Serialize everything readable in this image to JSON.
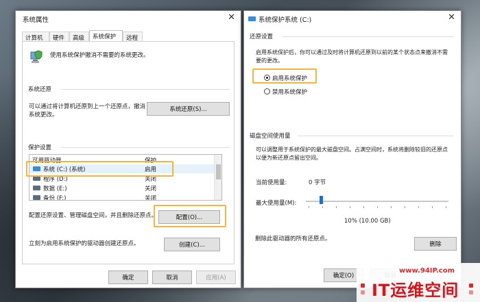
{
  "left_window": {
    "title": "系统属性",
    "tabs": [
      "计算机名",
      "硬件",
      "高级",
      "系统保护",
      "远程"
    ],
    "active_tab": "系统保护",
    "intro": "使用系统保护撤消不需要的系统更改。",
    "restore": {
      "section": "系统还原",
      "desc_line1": "可以通过将计算机还原到上一个还原点，撤消",
      "desc_line2": "系统更改。",
      "button": "系统还原(S)..."
    },
    "protection": {
      "section": "保护设置",
      "col_drives": "可用驱动器",
      "col_protect": "保护",
      "drives": [
        {
          "name": "系统 (C:) (系统)",
          "status": "启用"
        },
        {
          "name": "程序 (D:)",
          "status": "关闭"
        },
        {
          "name": "数据 (E:)",
          "status": "关闭"
        },
        {
          "name": "备份 (F:)",
          "status": "关闭"
        }
      ],
      "config_text": "配置还原设置、管理磁盘空间，并且删除还原点。",
      "config_button": "配置(O)...",
      "create_text": "立刻为启用系统保护的驱动器创建还原点。",
      "create_button": "创建(C)..."
    },
    "footer": {
      "ok": "确定",
      "cancel": "取消",
      "apply": "应用(A)"
    }
  },
  "right_window": {
    "title": "系统保护系统 (C:)",
    "restore_settings": {
      "section": "还原设置",
      "desc_line1": "启用系统保护后，你可以通过及时将计算机还原到以前的某个状态点来撤消不需",
      "desc_line2": "要的更改。",
      "option_on": "启用系统保护",
      "option_off": "禁用系统保护",
      "selected": "启用系统保护"
    },
    "disk": {
      "section": "磁盘空间使用量",
      "desc_line1": "可以调整用于系统保护的最大磁盘空间。占满空间时，系统将删除较旧的还原点",
      "desc_line2": "以便为新还原点留出空间。",
      "current_label": "当前使用量:",
      "current_value": "0 字节",
      "max_label": "最大使用量(M):",
      "max_percent": 10,
      "max_value": "10% (10.00 GB)",
      "delete_text": "删除此驱动器的所有还原点。",
      "delete_button": "删除"
    },
    "footer": {
      "ok": "确定(O)",
      "cancel": "取消"
    }
  },
  "watermark": {
    "url": "www.94IP.com",
    "name": "IT运维空间"
  },
  "colors": {
    "highlight": "#f4b63a",
    "slider": "#1f6fd1",
    "watermark": "#d8141a"
  }
}
